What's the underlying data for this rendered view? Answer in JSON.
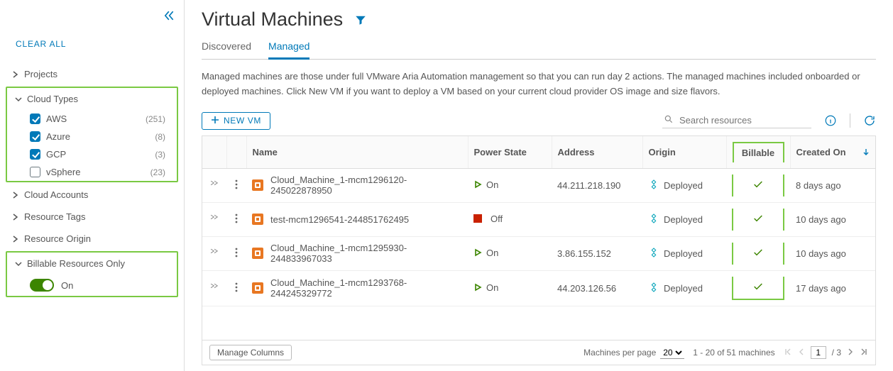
{
  "sidebar": {
    "clear_all": "CLEAR ALL",
    "groups": {
      "projects": "Projects",
      "cloud_types": "Cloud Types",
      "cloud_accounts": "Cloud Accounts",
      "resource_tags": "Resource Tags",
      "resource_origin": "Resource Origin",
      "billable_only": "Billable Resources Only"
    },
    "cloud_types": [
      {
        "label": "AWS",
        "count": "(251)",
        "checked": true
      },
      {
        "label": "Azure",
        "count": "(8)",
        "checked": true
      },
      {
        "label": "GCP",
        "count": "(3)",
        "checked": true
      },
      {
        "label": "vSphere",
        "count": "(23)",
        "checked": false
      }
    ],
    "billable_toggle": {
      "state": "On"
    }
  },
  "page": {
    "title": "Virtual Machines",
    "tabs": {
      "discovered": "Discovered",
      "managed": "Managed"
    },
    "description": "Managed machines are those under full VMware Aria Automation management so that you can run day 2 actions. The managed machines included onboarded or deployed machines. Click New VM if you want to deploy a VM based on your current cloud provider OS image and size flavors."
  },
  "toolbar": {
    "new_vm": "NEW VM",
    "search_placeholder": "Search resources"
  },
  "table": {
    "columns": {
      "name": "Name",
      "power": "Power State",
      "address": "Address",
      "origin": "Origin",
      "billable": "Billable",
      "created": "Created On"
    },
    "rows": [
      {
        "name": "Cloud_Machine_1-mcm1296120-245022878950",
        "power": "On",
        "address": "44.211.218.190",
        "origin": "Deployed",
        "billable": true,
        "created": "8 days ago"
      },
      {
        "name": "test-mcm1296541-244851762495",
        "power": "Off",
        "address": "",
        "origin": "Deployed",
        "billable": true,
        "created": "10 days ago"
      },
      {
        "name": "Cloud_Machine_1-mcm1295930-244833967033",
        "power": "On",
        "address": "3.86.155.152",
        "origin": "Deployed",
        "billable": true,
        "created": "10 days ago"
      },
      {
        "name": "Cloud_Machine_1-mcm1293768-244245329772",
        "power": "On",
        "address": "44.203.126.56",
        "origin": "Deployed",
        "billable": true,
        "created": "17 days ago"
      }
    ]
  },
  "footer": {
    "manage_columns": "Manage Columns",
    "per_page_label": "Machines per page",
    "per_page_value": "20",
    "range": "1 - 20 of 51 machines",
    "page_current": "1",
    "page_total": "/ 3"
  }
}
